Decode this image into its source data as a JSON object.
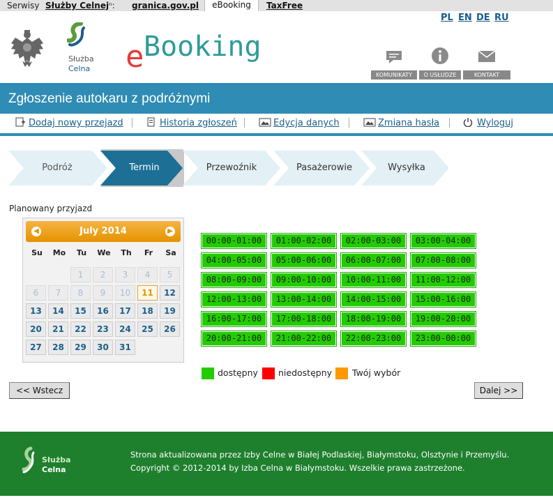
{
  "topbar": {
    "serwisy_prefix": "Serwisy",
    "sluzby_link": "Służby Celnej",
    "sluzby_suffix": "ⁿ:",
    "granica_link": "granica.gov.pl",
    "ebooking_tab": "eBooking",
    "taxfree_link": "TaxFree"
  },
  "header": {
    "langs": [
      "PL",
      "EN",
      "DE",
      "RU"
    ],
    "logo_text": "Booking",
    "logo_e": "e",
    "sluzba_line1": "Służba",
    "sluzba_line2": "Celna",
    "buttons": [
      "KOMUNIKATY",
      "O USŁUDZE",
      "KONTAKT"
    ]
  },
  "page_title": "Zgłoszenie autokaru z podróżnymi",
  "nav": {
    "items": [
      "Dodaj nowy przejazd",
      "Historia zgłoszeń",
      "Edycja danych",
      "Zmiana hasła",
      "Wyloguj"
    ]
  },
  "steps": {
    "items": [
      "Podróż",
      "Termin",
      "Przewoźnik",
      "Pasażerowie",
      "Wysyłka"
    ],
    "active_index": 1
  },
  "planned_label": "Planowany przyjazd",
  "calendar": {
    "month_label": "July 2014",
    "days_of_week": [
      "Su",
      "Mo",
      "Tu",
      "We",
      "Th",
      "Fr",
      "Sa"
    ],
    "weeks": [
      [
        "",
        "",
        "1",
        "2",
        "3",
        "4",
        "5"
      ],
      [
        "6",
        "7",
        "8",
        "9",
        "10",
        "11",
        "12"
      ],
      [
        "13",
        "14",
        "15",
        "16",
        "17",
        "18",
        "19"
      ],
      [
        "20",
        "21",
        "22",
        "23",
        "24",
        "25",
        "26"
      ],
      [
        "27",
        "28",
        "29",
        "30",
        "31",
        "",
        ""
      ]
    ],
    "disabled_until": 10,
    "today": "11"
  },
  "slots": [
    "00:00-01:00",
    "01:00-02:00",
    "02:00-03:00",
    "03:00-04:00",
    "04:00-05:00",
    "05:00-06:00",
    "06:00-07:00",
    "07:00-08:00",
    "08:00-09:00",
    "09:00-10:00",
    "10:00-11:00",
    "11:00-12:00",
    "12:00-13:00",
    "13:00-14:00",
    "14:00-15:00",
    "15:00-16:00",
    "16:00-17:00",
    "17:00-18:00",
    "18:00-19:00",
    "19:00-20:00",
    "20:00-21:00",
    "21:00-22:00",
    "22:00-23:00",
    "23:00-00:00"
  ],
  "legend": {
    "available": "dostępny",
    "unavailable": "niedostępny",
    "selected": "Twój wybór",
    "colors": {
      "available": "#22cc00",
      "unavailable": "#ff0000",
      "selected": "#ff9900"
    }
  },
  "buttons": {
    "back": "<< Wstecz",
    "next": "Dalej >>"
  },
  "footer": {
    "logo_line1": "Służba",
    "logo_line2": "Celna",
    "line1": "Strona aktualizowana przez Izby Celne w Białej Podlaskiej, Białymstoku, Olsztynie i Przemyślu.",
    "line2": "Copyright © 2012-2014 by Izba Celna w Białymstoku. Wszelkie prawa zastrzeżone."
  }
}
